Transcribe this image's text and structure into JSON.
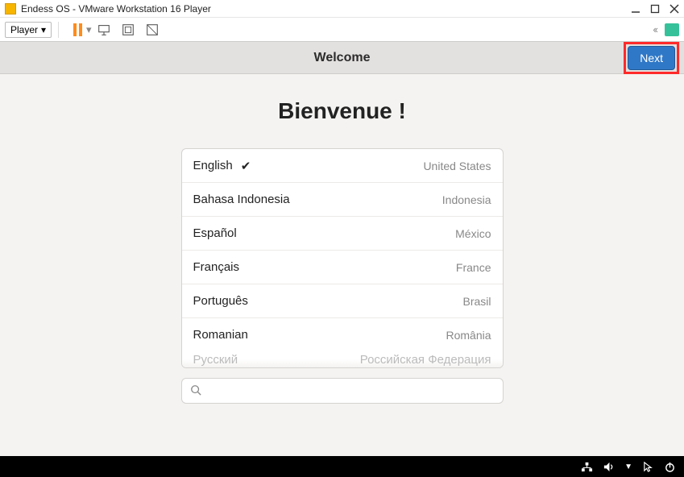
{
  "window": {
    "title": "Endess OS - VMware Workstation 16 Player"
  },
  "vmware_toolbar": {
    "player_label": "Player"
  },
  "guest_header": {
    "title": "Welcome",
    "next_label": "Next"
  },
  "content": {
    "big_title": "Bienvenue !"
  },
  "languages": [
    {
      "name": "English",
      "country": "United States",
      "selected": true
    },
    {
      "name": "Bahasa Indonesia",
      "country": "Indonesia",
      "selected": false
    },
    {
      "name": "Español",
      "country": "México",
      "selected": false
    },
    {
      "name": "Français",
      "country": "France",
      "selected": false
    },
    {
      "name": "Português",
      "country": "Brasil",
      "selected": false
    },
    {
      "name": "Romanian",
      "country": "România",
      "selected": false
    }
  ],
  "languages_cutoff": {
    "name": "Русский",
    "country": "Российская Федерация"
  },
  "search": {
    "placeholder": ""
  }
}
